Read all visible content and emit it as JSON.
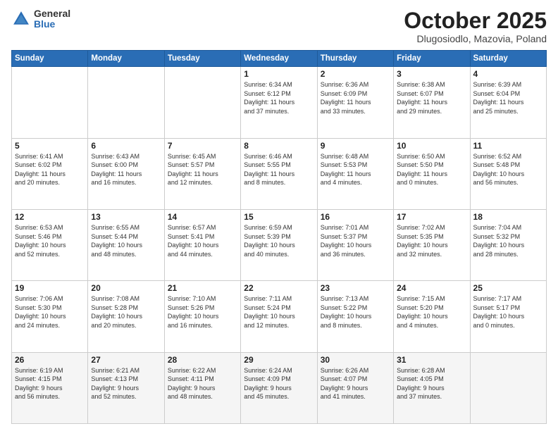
{
  "logo": {
    "general": "General",
    "blue": "Blue"
  },
  "header": {
    "month": "October 2025",
    "location": "Dlugosiodlo, Mazovia, Poland"
  },
  "days_of_week": [
    "Sunday",
    "Monday",
    "Tuesday",
    "Wednesday",
    "Thursday",
    "Friday",
    "Saturday"
  ],
  "weeks": [
    [
      {
        "day": "",
        "info": ""
      },
      {
        "day": "",
        "info": ""
      },
      {
        "day": "",
        "info": ""
      },
      {
        "day": "1",
        "info": "Sunrise: 6:34 AM\nSunset: 6:12 PM\nDaylight: 11 hours\nand 37 minutes."
      },
      {
        "day": "2",
        "info": "Sunrise: 6:36 AM\nSunset: 6:09 PM\nDaylight: 11 hours\nand 33 minutes."
      },
      {
        "day": "3",
        "info": "Sunrise: 6:38 AM\nSunset: 6:07 PM\nDaylight: 11 hours\nand 29 minutes."
      },
      {
        "day": "4",
        "info": "Sunrise: 6:39 AM\nSunset: 6:04 PM\nDaylight: 11 hours\nand 25 minutes."
      }
    ],
    [
      {
        "day": "5",
        "info": "Sunrise: 6:41 AM\nSunset: 6:02 PM\nDaylight: 11 hours\nand 20 minutes."
      },
      {
        "day": "6",
        "info": "Sunrise: 6:43 AM\nSunset: 6:00 PM\nDaylight: 11 hours\nand 16 minutes."
      },
      {
        "day": "7",
        "info": "Sunrise: 6:45 AM\nSunset: 5:57 PM\nDaylight: 11 hours\nand 12 minutes."
      },
      {
        "day": "8",
        "info": "Sunrise: 6:46 AM\nSunset: 5:55 PM\nDaylight: 11 hours\nand 8 minutes."
      },
      {
        "day": "9",
        "info": "Sunrise: 6:48 AM\nSunset: 5:53 PM\nDaylight: 11 hours\nand 4 minutes."
      },
      {
        "day": "10",
        "info": "Sunrise: 6:50 AM\nSunset: 5:50 PM\nDaylight: 11 hours\nand 0 minutes."
      },
      {
        "day": "11",
        "info": "Sunrise: 6:52 AM\nSunset: 5:48 PM\nDaylight: 10 hours\nand 56 minutes."
      }
    ],
    [
      {
        "day": "12",
        "info": "Sunrise: 6:53 AM\nSunset: 5:46 PM\nDaylight: 10 hours\nand 52 minutes."
      },
      {
        "day": "13",
        "info": "Sunrise: 6:55 AM\nSunset: 5:44 PM\nDaylight: 10 hours\nand 48 minutes."
      },
      {
        "day": "14",
        "info": "Sunrise: 6:57 AM\nSunset: 5:41 PM\nDaylight: 10 hours\nand 44 minutes."
      },
      {
        "day": "15",
        "info": "Sunrise: 6:59 AM\nSunset: 5:39 PM\nDaylight: 10 hours\nand 40 minutes."
      },
      {
        "day": "16",
        "info": "Sunrise: 7:01 AM\nSunset: 5:37 PM\nDaylight: 10 hours\nand 36 minutes."
      },
      {
        "day": "17",
        "info": "Sunrise: 7:02 AM\nSunset: 5:35 PM\nDaylight: 10 hours\nand 32 minutes."
      },
      {
        "day": "18",
        "info": "Sunrise: 7:04 AM\nSunset: 5:32 PM\nDaylight: 10 hours\nand 28 minutes."
      }
    ],
    [
      {
        "day": "19",
        "info": "Sunrise: 7:06 AM\nSunset: 5:30 PM\nDaylight: 10 hours\nand 24 minutes."
      },
      {
        "day": "20",
        "info": "Sunrise: 7:08 AM\nSunset: 5:28 PM\nDaylight: 10 hours\nand 20 minutes."
      },
      {
        "day": "21",
        "info": "Sunrise: 7:10 AM\nSunset: 5:26 PM\nDaylight: 10 hours\nand 16 minutes."
      },
      {
        "day": "22",
        "info": "Sunrise: 7:11 AM\nSunset: 5:24 PM\nDaylight: 10 hours\nand 12 minutes."
      },
      {
        "day": "23",
        "info": "Sunrise: 7:13 AM\nSunset: 5:22 PM\nDaylight: 10 hours\nand 8 minutes."
      },
      {
        "day": "24",
        "info": "Sunrise: 7:15 AM\nSunset: 5:20 PM\nDaylight: 10 hours\nand 4 minutes."
      },
      {
        "day": "25",
        "info": "Sunrise: 7:17 AM\nSunset: 5:17 PM\nDaylight: 10 hours\nand 0 minutes."
      }
    ],
    [
      {
        "day": "26",
        "info": "Sunrise: 6:19 AM\nSunset: 4:15 PM\nDaylight: 9 hours\nand 56 minutes."
      },
      {
        "day": "27",
        "info": "Sunrise: 6:21 AM\nSunset: 4:13 PM\nDaylight: 9 hours\nand 52 minutes."
      },
      {
        "day": "28",
        "info": "Sunrise: 6:22 AM\nSunset: 4:11 PM\nDaylight: 9 hours\nand 48 minutes."
      },
      {
        "day": "29",
        "info": "Sunrise: 6:24 AM\nSunset: 4:09 PM\nDaylight: 9 hours\nand 45 minutes."
      },
      {
        "day": "30",
        "info": "Sunrise: 6:26 AM\nSunset: 4:07 PM\nDaylight: 9 hours\nand 41 minutes."
      },
      {
        "day": "31",
        "info": "Sunrise: 6:28 AM\nSunset: 4:05 PM\nDaylight: 9 hours\nand 37 minutes."
      },
      {
        "day": "",
        "info": ""
      }
    ]
  ]
}
